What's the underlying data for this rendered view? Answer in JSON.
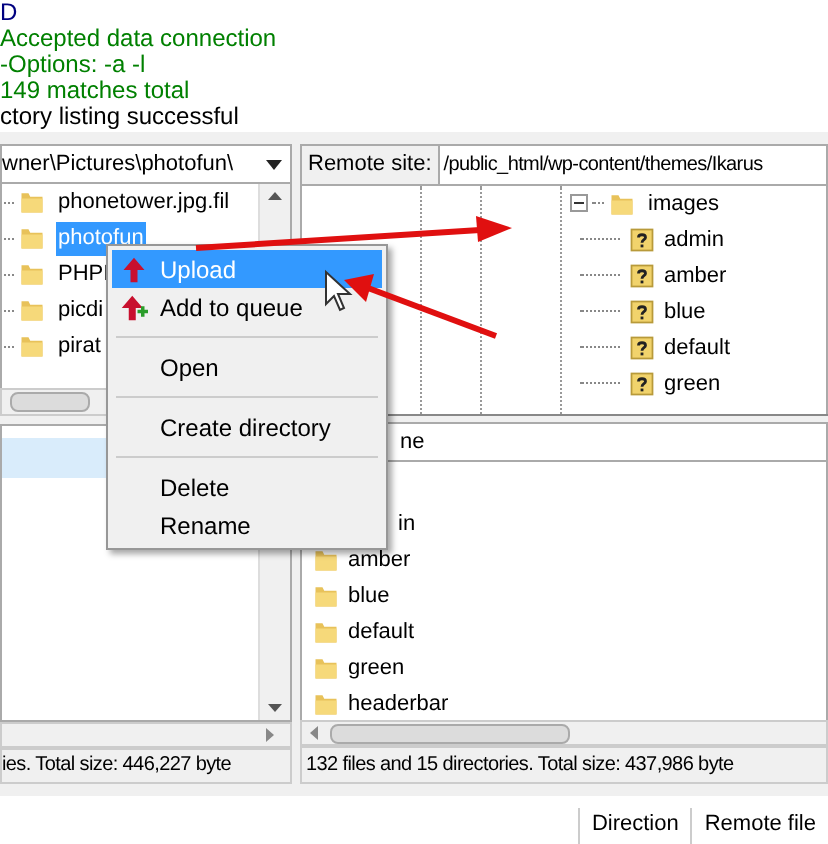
{
  "log": [
    {
      "text": "D",
      "kind": "command"
    },
    {
      "text": "Accepted data connection",
      "kind": "response"
    },
    {
      "text": "-Options: -a -l",
      "kind": "response"
    },
    {
      "text": "149 matches total",
      "kind": "response"
    },
    {
      "text": "ctory listing successful",
      "kind": "status"
    }
  ],
  "local": {
    "path": "wner\\Pictures\\photofun\\",
    "tree": [
      {
        "name": "phonetower.jpg.fil",
        "selected": false
      },
      {
        "name": "photofun",
        "selected": true
      },
      {
        "name": "PHPI",
        "selected": false
      },
      {
        "name": "picdi",
        "selected": false
      },
      {
        "name": "pirat",
        "selected": false
      }
    ],
    "status": "ies. Total size: 446,227 byte"
  },
  "remote": {
    "label": "Remote site:",
    "path": "/public_html/wp-content/themes/Ikarus",
    "tree": {
      "name": "images",
      "expanded": true,
      "children": [
        {
          "name": "admin"
        },
        {
          "name": "amber"
        },
        {
          "name": "blue"
        },
        {
          "name": "default"
        },
        {
          "name": "green"
        }
      ]
    },
    "list_header": "ne",
    "files": [
      "in",
      "amber",
      "blue",
      "default",
      "green",
      "headerbar"
    ],
    "status": "132 files and 15 directories. Total size: 437,986 byte"
  },
  "context_menu": [
    {
      "kind": "item",
      "label": "Upload",
      "selected": true
    },
    {
      "kind": "item",
      "label": "Add to queue",
      "selected": false
    },
    {
      "kind": "separator"
    },
    {
      "kind": "item",
      "label": "Open",
      "selected": false
    },
    {
      "kind": "separator"
    },
    {
      "kind": "item",
      "label": "Create directory",
      "selected": false
    },
    {
      "kind": "separator"
    },
    {
      "kind": "item",
      "label": "Delete",
      "selected": false
    },
    {
      "kind": "item",
      "label": "Rename",
      "selected": false
    }
  ],
  "queue": {
    "columns": [
      "Direction",
      "Remote file"
    ]
  }
}
